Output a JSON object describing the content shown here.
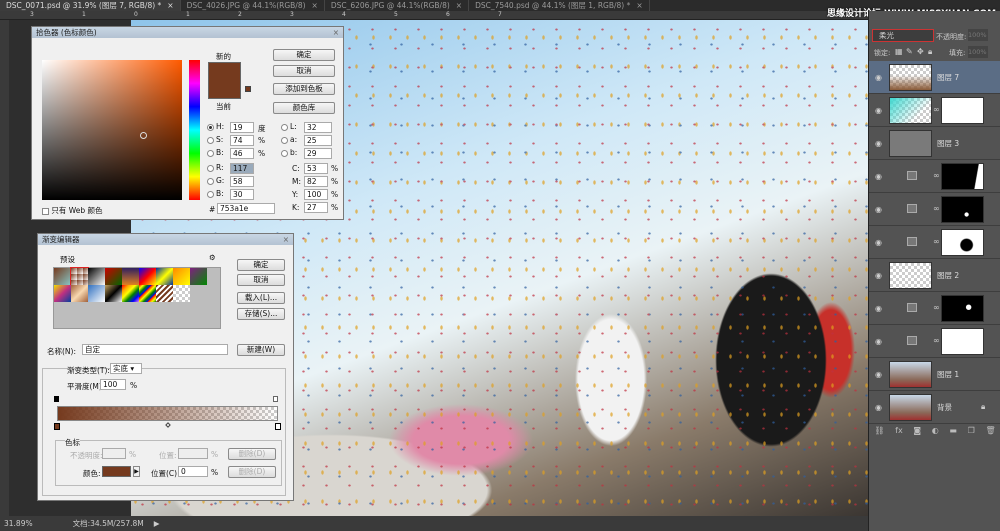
{
  "tabs": [
    {
      "label": "DSC_0071.psd @ 31.9% (图层 7, RGB/8) *",
      "active": true
    },
    {
      "label": "DSC_4026.JPG @ 44.1%(RGB/8)",
      "active": false
    },
    {
      "label": "DSC_6206.JPG @ 44.1%(RGB/8)",
      "active": false
    },
    {
      "label": "DSC_7540.psd @ 44.1% (图层 1, RGB/8) *",
      "active": false
    }
  ],
  "close_glyph": "×",
  "ruler_ticks": [
    "3",
    "1",
    "0",
    "1",
    "2",
    "3",
    "4",
    "5",
    "6",
    "7"
  ],
  "watermark": "思缘设计论坛 WWW.MISSYUAN.COM",
  "status": {
    "zoom": "31.89%",
    "doc": "文档:34.5M/257.8M",
    "arrow": "▶"
  },
  "color_picker": {
    "title": "拾色器 (色标颜色)",
    "new_label": "新的",
    "current_label": "当前",
    "new_color": "#753a1e",
    "buttons": {
      "ok": "确定",
      "cancel": "取消",
      "add_swatch": "添加到色板",
      "libraries": "颜色库"
    },
    "fields": {
      "H": {
        "label": "H:",
        "value": "19",
        "unit": "度"
      },
      "S": {
        "label": "S:",
        "value": "74",
        "unit": "%"
      },
      "Bv": {
        "label": "B:",
        "value": "46",
        "unit": "%"
      },
      "R": {
        "label": "R:",
        "value": "117"
      },
      "G": {
        "label": "G:",
        "value": "58"
      },
      "B": {
        "label": "B:",
        "value": "30"
      },
      "L": {
        "label": "L:",
        "value": "32"
      },
      "a": {
        "label": "a:",
        "value": "25"
      },
      "b": {
        "label": "b:",
        "value": "29"
      },
      "C": {
        "label": "C:",
        "value": "53",
        "unit": "%"
      },
      "M": {
        "label": "M:",
        "value": "82",
        "unit": "%"
      },
      "Y": {
        "label": "Y:",
        "value": "100",
        "unit": "%"
      },
      "K": {
        "label": "K:",
        "value": "27",
        "unit": "%"
      }
    },
    "hex_label": "#",
    "hex": "753a1e",
    "web_only": "只有 Web 颜色"
  },
  "gradient_editor": {
    "title": "渐变编辑器",
    "presets_label": "预设",
    "buttons": {
      "ok": "确定",
      "cancel": "取消",
      "load": "载入(L)...",
      "save": "存储(S)...",
      "new": "新建(W)",
      "delete": "删除(D)"
    },
    "name_label": "名称(N):",
    "name_value": "自定",
    "type_label": "渐变类型(T):",
    "type_value": "实底",
    "smooth_label": "平滑度(M):",
    "smooth_value": "100",
    "pct": "%",
    "stops_label": "色标",
    "opacity_label": "不透明度:",
    "location_label": "位置:",
    "color_label": "颜色:",
    "location_c_label": "位置(C):",
    "location_c_value": "0",
    "stop_color": "#753a1e"
  },
  "layers_panel": {
    "blend_mode": "柔光",
    "opacity_label": "不透明度:",
    "opacity": "100%",
    "lock_label": "锁定:",
    "fill_label": "填充:",
    "fill": "100%",
    "layers": [
      {
        "name": "图层 7",
        "selected": true,
        "kind": "grad"
      },
      {
        "name": "",
        "kind": "cyan-mask"
      },
      {
        "name": "图层 3",
        "kind": "gray"
      },
      {
        "name": "",
        "kind": "adj-mask"
      },
      {
        "name": "",
        "kind": "curve-mask"
      },
      {
        "name": "",
        "kind": "adj-mask2"
      },
      {
        "name": "图层 2",
        "kind": "empty"
      },
      {
        "name": "",
        "kind": "adj-mask3"
      },
      {
        "name": "",
        "kind": "adj-white"
      },
      {
        "name": "图层 1",
        "kind": "photo"
      },
      {
        "name": "背景",
        "kind": "photo",
        "locked": true
      }
    ],
    "footer_icons": [
      "link-icon",
      "fx-icon",
      "mask-icon",
      "adjustment-icon",
      "folder-icon",
      "new-layer-icon",
      "trash-icon"
    ]
  }
}
